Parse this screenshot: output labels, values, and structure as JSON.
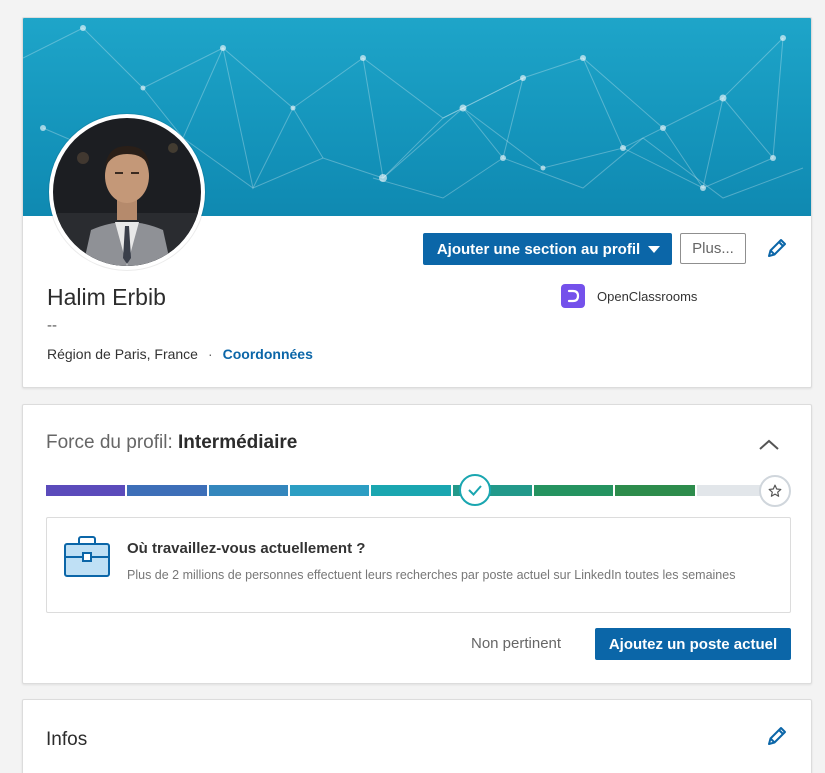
{
  "profile": {
    "name": "Halim Erbib",
    "headline": "--",
    "location": "Région de Paris, France",
    "separator": "·",
    "contact_link": "Coordonnées",
    "add_section_button": "Ajouter une section au profil",
    "more_button": "Plus...",
    "company": {
      "name": "OpenClassrooms",
      "logo_color": "#7451eb"
    }
  },
  "strength": {
    "label": "Force du profil:",
    "level": "Intermédiaire",
    "progress_fraction": 0.86,
    "segment_colors": [
      "#5b4bbb",
      "#3d6fb8",
      "#3487bd",
      "#2c9ec3",
      "#1aa6b0",
      "#22998a",
      "#259360",
      "#2d8c4c",
      "#e2e6ea"
    ],
    "suggestion": {
      "title": "Où travaillez-vous actuellement ?",
      "description": "Plus de 2 millions de personnes effectuent leurs recherches par poste actuel sur LinkedIn toutes les semaines"
    },
    "dismiss_button": "Non pertinent",
    "primary_button": "Ajoutez un poste actuel"
  },
  "infos": {
    "title": "Infos"
  },
  "colors": {
    "accent": "#0b66a8",
    "banner": "#1494bb"
  }
}
